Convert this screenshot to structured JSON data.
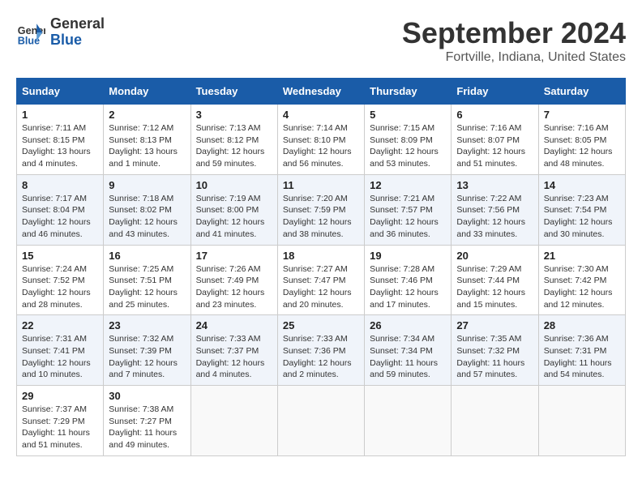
{
  "header": {
    "logo_line1": "General",
    "logo_line2": "Blue",
    "month_year": "September 2024",
    "location": "Fortville, Indiana, United States"
  },
  "days_of_week": [
    "Sunday",
    "Monday",
    "Tuesday",
    "Wednesday",
    "Thursday",
    "Friday",
    "Saturday"
  ],
  "weeks": [
    [
      {
        "day": "1",
        "info": "Sunrise: 7:11 AM\nSunset: 8:15 PM\nDaylight: 13 hours\nand 4 minutes."
      },
      {
        "day": "2",
        "info": "Sunrise: 7:12 AM\nSunset: 8:13 PM\nDaylight: 13 hours\nand 1 minute."
      },
      {
        "day": "3",
        "info": "Sunrise: 7:13 AM\nSunset: 8:12 PM\nDaylight: 12 hours\nand 59 minutes."
      },
      {
        "day": "4",
        "info": "Sunrise: 7:14 AM\nSunset: 8:10 PM\nDaylight: 12 hours\nand 56 minutes."
      },
      {
        "day": "5",
        "info": "Sunrise: 7:15 AM\nSunset: 8:09 PM\nDaylight: 12 hours\nand 53 minutes."
      },
      {
        "day": "6",
        "info": "Sunrise: 7:16 AM\nSunset: 8:07 PM\nDaylight: 12 hours\nand 51 minutes."
      },
      {
        "day": "7",
        "info": "Sunrise: 7:16 AM\nSunset: 8:05 PM\nDaylight: 12 hours\nand 48 minutes."
      }
    ],
    [
      {
        "day": "8",
        "info": "Sunrise: 7:17 AM\nSunset: 8:04 PM\nDaylight: 12 hours\nand 46 minutes."
      },
      {
        "day": "9",
        "info": "Sunrise: 7:18 AM\nSunset: 8:02 PM\nDaylight: 12 hours\nand 43 minutes."
      },
      {
        "day": "10",
        "info": "Sunrise: 7:19 AM\nSunset: 8:00 PM\nDaylight: 12 hours\nand 41 minutes."
      },
      {
        "day": "11",
        "info": "Sunrise: 7:20 AM\nSunset: 7:59 PM\nDaylight: 12 hours\nand 38 minutes."
      },
      {
        "day": "12",
        "info": "Sunrise: 7:21 AM\nSunset: 7:57 PM\nDaylight: 12 hours\nand 36 minutes."
      },
      {
        "day": "13",
        "info": "Sunrise: 7:22 AM\nSunset: 7:56 PM\nDaylight: 12 hours\nand 33 minutes."
      },
      {
        "day": "14",
        "info": "Sunrise: 7:23 AM\nSunset: 7:54 PM\nDaylight: 12 hours\nand 30 minutes."
      }
    ],
    [
      {
        "day": "15",
        "info": "Sunrise: 7:24 AM\nSunset: 7:52 PM\nDaylight: 12 hours\nand 28 minutes."
      },
      {
        "day": "16",
        "info": "Sunrise: 7:25 AM\nSunset: 7:51 PM\nDaylight: 12 hours\nand 25 minutes."
      },
      {
        "day": "17",
        "info": "Sunrise: 7:26 AM\nSunset: 7:49 PM\nDaylight: 12 hours\nand 23 minutes."
      },
      {
        "day": "18",
        "info": "Sunrise: 7:27 AM\nSunset: 7:47 PM\nDaylight: 12 hours\nand 20 minutes."
      },
      {
        "day": "19",
        "info": "Sunrise: 7:28 AM\nSunset: 7:46 PM\nDaylight: 12 hours\nand 17 minutes."
      },
      {
        "day": "20",
        "info": "Sunrise: 7:29 AM\nSunset: 7:44 PM\nDaylight: 12 hours\nand 15 minutes."
      },
      {
        "day": "21",
        "info": "Sunrise: 7:30 AM\nSunset: 7:42 PM\nDaylight: 12 hours\nand 12 minutes."
      }
    ],
    [
      {
        "day": "22",
        "info": "Sunrise: 7:31 AM\nSunset: 7:41 PM\nDaylight: 12 hours\nand 10 minutes."
      },
      {
        "day": "23",
        "info": "Sunrise: 7:32 AM\nSunset: 7:39 PM\nDaylight: 12 hours\nand 7 minutes."
      },
      {
        "day": "24",
        "info": "Sunrise: 7:33 AM\nSunset: 7:37 PM\nDaylight: 12 hours\nand 4 minutes."
      },
      {
        "day": "25",
        "info": "Sunrise: 7:33 AM\nSunset: 7:36 PM\nDaylight: 12 hours\nand 2 minutes."
      },
      {
        "day": "26",
        "info": "Sunrise: 7:34 AM\nSunset: 7:34 PM\nDaylight: 11 hours\nand 59 minutes."
      },
      {
        "day": "27",
        "info": "Sunrise: 7:35 AM\nSunset: 7:32 PM\nDaylight: 11 hours\nand 57 minutes."
      },
      {
        "day": "28",
        "info": "Sunrise: 7:36 AM\nSunset: 7:31 PM\nDaylight: 11 hours\nand 54 minutes."
      }
    ],
    [
      {
        "day": "29",
        "info": "Sunrise: 7:37 AM\nSunset: 7:29 PM\nDaylight: 11 hours\nand 51 minutes."
      },
      {
        "day": "30",
        "info": "Sunrise: 7:38 AM\nSunset: 7:27 PM\nDaylight: 11 hours\nand 49 minutes."
      },
      {
        "day": "",
        "info": ""
      },
      {
        "day": "",
        "info": ""
      },
      {
        "day": "",
        "info": ""
      },
      {
        "day": "",
        "info": ""
      },
      {
        "day": "",
        "info": ""
      }
    ]
  ]
}
